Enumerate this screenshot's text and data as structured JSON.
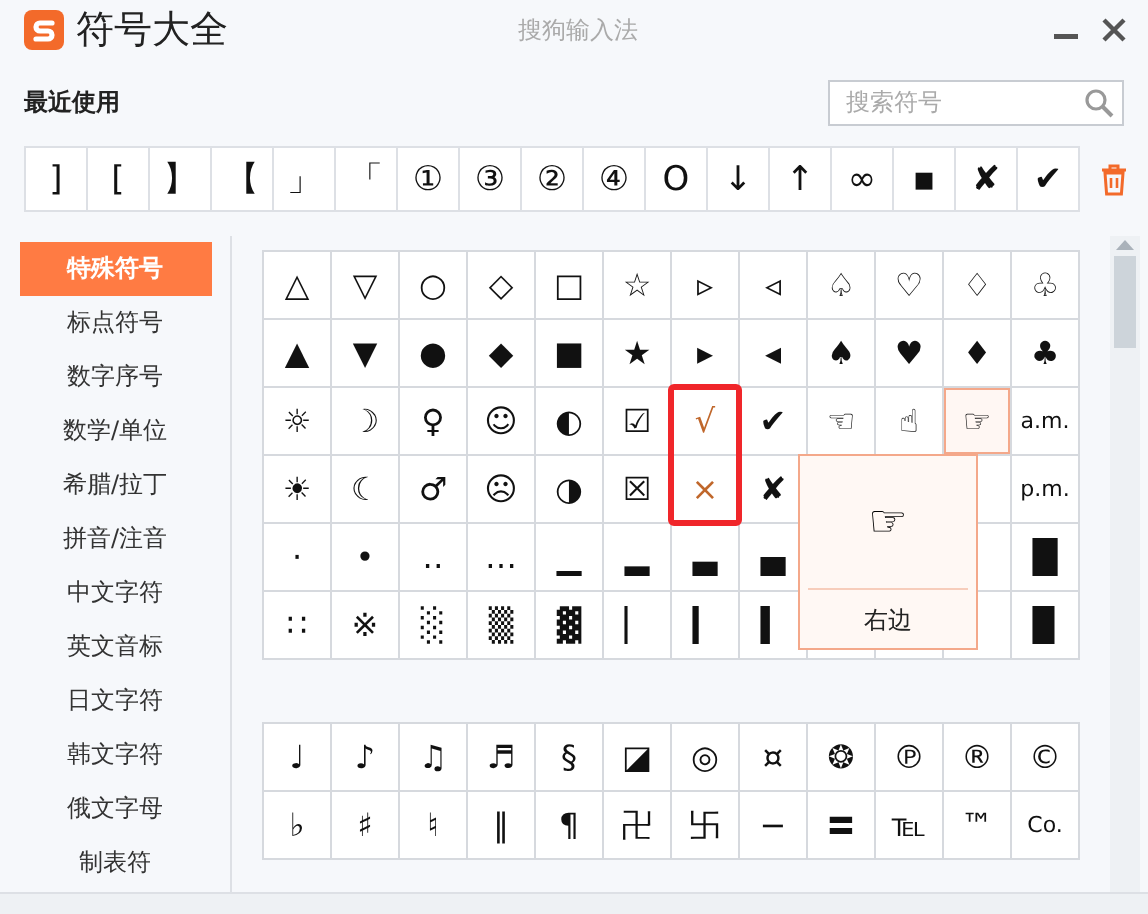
{
  "window": {
    "title": "符号大全",
    "app_name": "搜狗输入法"
  },
  "recent": {
    "label": "最近使用",
    "symbols": [
      "]",
      "[",
      "】",
      "【",
      "」",
      "「",
      "①",
      "③",
      "②",
      "④",
      "O",
      "↓",
      "↑",
      "∞",
      "▪",
      "✘",
      "✔"
    ]
  },
  "search": {
    "placeholder": "搜索符号"
  },
  "categories": [
    {
      "label": "特殊符号",
      "selected": true
    },
    {
      "label": "标点符号",
      "selected": false
    },
    {
      "label": "数字序号",
      "selected": false
    },
    {
      "label": "数学/单位",
      "selected": false
    },
    {
      "label": "希腊/拉丁",
      "selected": false
    },
    {
      "label": "拼音/注音",
      "selected": false
    },
    {
      "label": "中文字符",
      "selected": false
    },
    {
      "label": "英文音标",
      "selected": false
    },
    {
      "label": "日文字符",
      "selected": false
    },
    {
      "label": "韩文字符",
      "selected": false
    },
    {
      "label": "俄文字母",
      "selected": false
    },
    {
      "label": "制表符",
      "selected": false
    }
  ],
  "groups": [
    {
      "rows": [
        [
          {
            "symbol": "△"
          },
          {
            "symbol": "▽"
          },
          {
            "symbol": "○"
          },
          {
            "symbol": "◇"
          },
          {
            "symbol": "□"
          },
          {
            "symbol": "☆"
          },
          {
            "symbol": "▹"
          },
          {
            "symbol": "◃"
          },
          {
            "symbol": "♤"
          },
          {
            "symbol": "♡"
          },
          {
            "symbol": "♢"
          },
          {
            "symbol": "♧"
          }
        ],
        [
          {
            "symbol": "▲"
          },
          {
            "symbol": "▼"
          },
          {
            "symbol": "●"
          },
          {
            "symbol": "◆"
          },
          {
            "symbol": "■"
          },
          {
            "symbol": "★"
          },
          {
            "symbol": "▸"
          },
          {
            "symbol": "◂"
          },
          {
            "symbol": "♠"
          },
          {
            "symbol": "♥"
          },
          {
            "symbol": "♦"
          },
          {
            "symbol": "♣"
          }
        ],
        [
          {
            "symbol": "☼"
          },
          {
            "symbol": "☽"
          },
          {
            "symbol": "♀"
          },
          {
            "symbol": "☺"
          },
          {
            "symbol": "◐"
          },
          {
            "symbol": "☑"
          },
          {
            "symbol": "√",
            "boxed": true
          },
          {
            "symbol": "✔"
          },
          {
            "symbol": "☜"
          },
          {
            "symbol": "☝"
          },
          {
            "symbol": "☞",
            "hovered": true,
            "tooltip": "右边"
          },
          {
            "symbol": "a.m."
          }
        ],
        [
          {
            "symbol": "☀"
          },
          {
            "symbol": "☾"
          },
          {
            "symbol": "♂"
          },
          {
            "symbol": "☹"
          },
          {
            "symbol": "◑"
          },
          {
            "symbol": "☒"
          },
          {
            "symbol": "×",
            "boxed": true
          },
          {
            "symbol": "✘"
          },
          null,
          null,
          null,
          {
            "symbol": "p.m."
          }
        ],
        [
          {
            "symbol": "·"
          },
          {
            "symbol": "•"
          },
          {
            "symbol": "‥"
          },
          {
            "symbol": "…"
          },
          {
            "symbol": "▁"
          },
          {
            "symbol": "▂"
          },
          {
            "symbol": "▃"
          },
          {
            "symbol": "▄"
          },
          null,
          null,
          null,
          {
            "symbol": "█"
          }
        ],
        [
          {
            "symbol": "∷"
          },
          {
            "symbol": "※"
          },
          {
            "symbol": "░"
          },
          {
            "symbol": "▒"
          },
          {
            "symbol": "▓"
          },
          {
            "symbol": "▏"
          },
          {
            "symbol": "▎"
          },
          {
            "symbol": "▍"
          },
          null,
          null,
          null,
          {
            "symbol": "▉"
          }
        ]
      ]
    },
    {
      "rows": [
        [
          {
            "symbol": "♩"
          },
          {
            "symbol": "♪"
          },
          {
            "symbol": "♫"
          },
          {
            "symbol": "♬"
          },
          {
            "symbol": "§"
          },
          {
            "symbol": "◪"
          },
          {
            "symbol": "◎"
          },
          {
            "symbol": "¤"
          },
          {
            "symbol": "❂"
          },
          {
            "symbol": "℗"
          },
          {
            "symbol": "®"
          },
          {
            "symbol": "©"
          }
        ],
        [
          {
            "symbol": "♭"
          },
          {
            "symbol": "♯"
          },
          {
            "symbol": "♮"
          },
          {
            "symbol": "‖"
          },
          {
            "symbol": "¶"
          },
          {
            "symbol": "卍"
          },
          {
            "symbol": "卐"
          },
          {
            "symbol": "−"
          },
          {
            "symbol": "〓"
          },
          {
            "symbol": "℡"
          },
          {
            "symbol": "™"
          },
          {
            "symbol": "Co."
          }
        ]
      ]
    }
  ]
}
